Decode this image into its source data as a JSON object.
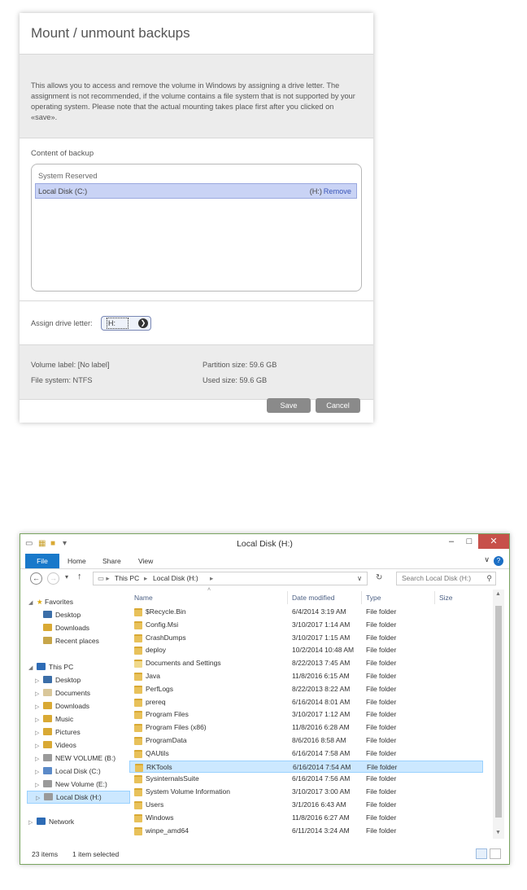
{
  "dialog": {
    "title": "Mount / unmount backups",
    "info": "This allows you to access and remove the volume in Windows by assigning a drive letter. The assignment is not recommended, if the volume contains a file system that is not supported by your operating system. Please note that the actual mounting takes place first after you clicked on «save».",
    "content_label": "Content of backup",
    "group": "System Reserved",
    "disk": {
      "name": "Local Disk (C:)",
      "letter": "(H:)",
      "action": "Remove"
    },
    "assign_label": "Assign drive letter:",
    "drive_letter": "H:",
    "volume_label": "Volume label:  [No label]",
    "file_system": "File system:  NTFS",
    "partition_size": "Partition size:  59.6 GB",
    "used_size": "Used size:  59.6 GB",
    "save": "Save",
    "cancel": "Cancel"
  },
  "explorer": {
    "title": "Local Disk (H:)",
    "ribbon_tabs": [
      "File",
      "Home",
      "Share",
      "View"
    ],
    "address": [
      "This PC",
      "Local Disk (H:)"
    ],
    "search_placeholder": "Search Local Disk (H:)",
    "nav": {
      "favorites": "Favorites",
      "fav_items": [
        "Desktop",
        "Downloads",
        "Recent places"
      ],
      "this_pc": "This PC",
      "pc_items": [
        "Desktop",
        "Documents",
        "Downloads",
        "Music",
        "Pictures",
        "Videos",
        "NEW VOLUME (B:)",
        "Local Disk (C:)",
        "New Volume (E:)",
        "Local Disk (H:)"
      ],
      "network": "Network"
    },
    "columns": [
      "Name",
      "Date modified",
      "Type",
      "Size"
    ],
    "files": [
      {
        "name": "$Recycle.Bin",
        "date": "6/4/2014 3:19 AM",
        "type": "File folder"
      },
      {
        "name": "Config.Msi",
        "date": "3/10/2017 1:14 AM",
        "type": "File folder"
      },
      {
        "name": "CrashDumps",
        "date": "3/10/2017 1:15 AM",
        "type": "File folder"
      },
      {
        "name": "deploy",
        "date": "10/2/2014 10:48 AM",
        "type": "File folder"
      },
      {
        "name": "Documents and Settings",
        "date": "8/22/2013 7:45 AM",
        "type": "File folder"
      },
      {
        "name": "Java",
        "date": "11/8/2016 6:15 AM",
        "type": "File folder"
      },
      {
        "name": "PerfLogs",
        "date": "8/22/2013 8:22 AM",
        "type": "File folder"
      },
      {
        "name": "prereq",
        "date": "6/16/2014 8:01 AM",
        "type": "File folder"
      },
      {
        "name": "Program Files",
        "date": "3/10/2017 1:12 AM",
        "type": "File folder"
      },
      {
        "name": "Program Files (x86)",
        "date": "11/8/2016 6:28 AM",
        "type": "File folder"
      },
      {
        "name": "ProgramData",
        "date": "8/6/2016 8:58 AM",
        "type": "File folder"
      },
      {
        "name": "QAUtils",
        "date": "6/16/2014 7:58 AM",
        "type": "File folder"
      },
      {
        "name": "RKTools",
        "date": "6/16/2014 7:54 AM",
        "type": "File folder"
      },
      {
        "name": "SysinternalsSuite",
        "date": "6/16/2014 7:56 AM",
        "type": "File folder"
      },
      {
        "name": "System Volume Information",
        "date": "3/10/2017 3:00 AM",
        "type": "File folder"
      },
      {
        "name": "Users",
        "date": "3/1/2016 6:43 AM",
        "type": "File folder"
      },
      {
        "name": "Windows",
        "date": "11/8/2016 6:27 AM",
        "type": "File folder"
      },
      {
        "name": "winpe_amd64",
        "date": "6/11/2014 3:24 AM",
        "type": "File folder"
      }
    ],
    "status_count": "23 items",
    "status_selected": "1 item selected"
  }
}
